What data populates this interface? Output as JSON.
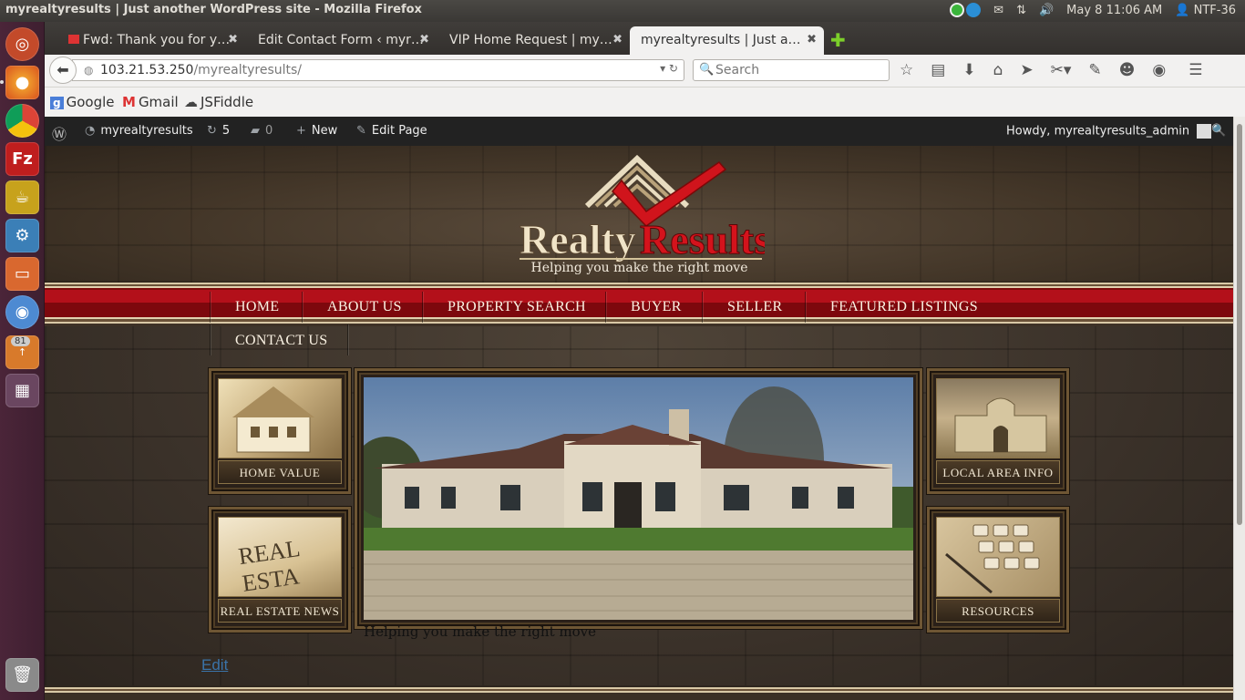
{
  "os_panel": {
    "window_title": "myrealtyresults | Just another WordPress site - Mozilla Firefox",
    "datetime": "May 8 11:06 AM",
    "user": "NTF-36"
  },
  "launcher": {
    "badge_count": "81"
  },
  "tabs": [
    {
      "label": "Fwd: Thank you for y…",
      "favicon": "gmail-icon"
    },
    {
      "label": "Edit Contact Form ‹ myr…",
      "favicon": "none"
    },
    {
      "label": "VIP Home Request | my…",
      "favicon": "none"
    },
    {
      "label": "myrealtyresults | Just a…",
      "favicon": "none",
      "active": true
    }
  ],
  "navbar": {
    "url_host": "103.21.53.250",
    "url_path": "/myrealtyresults/",
    "search_placeholder": "Search"
  },
  "bookmarks": [
    {
      "label": "Google",
      "icon": "google-icon"
    },
    {
      "label": "Gmail",
      "icon": "gmail-icon"
    },
    {
      "label": "JSFiddle",
      "icon": "cloud-icon"
    }
  ],
  "wp_admin_bar": {
    "site_name": "myrealtyresults",
    "updates_count": "5",
    "comments_count": "0",
    "new_label": "New",
    "edit_page_label": "Edit Page",
    "howdy": "Howdy, myrealtyresults_admin"
  },
  "site": {
    "logo_text_1": "Realty",
    "logo_text_2": "Results",
    "tagline": "Helping you make the right move",
    "menu": [
      "HOME",
      "ABOUT US",
      "PROPERTY SEARCH",
      "BUYER",
      "SELLER",
      "FEATURED LISTINGS",
      "CONTACT US"
    ],
    "tiles": {
      "home_value": "HOME VALUE",
      "real_estate_news": "REAL ESTATE NEWS",
      "local_area_info": "LOCAL AREA INFO",
      "resources": "RESOURCES"
    },
    "thumb_text": "REAL ESTA",
    "slider_caption": "Helping you make the right move",
    "edit_link": "Edit"
  },
  "colors": {
    "menu_red": "#b3101a",
    "wp_bar": "#222222",
    "link_blue": "#3a73a8"
  }
}
